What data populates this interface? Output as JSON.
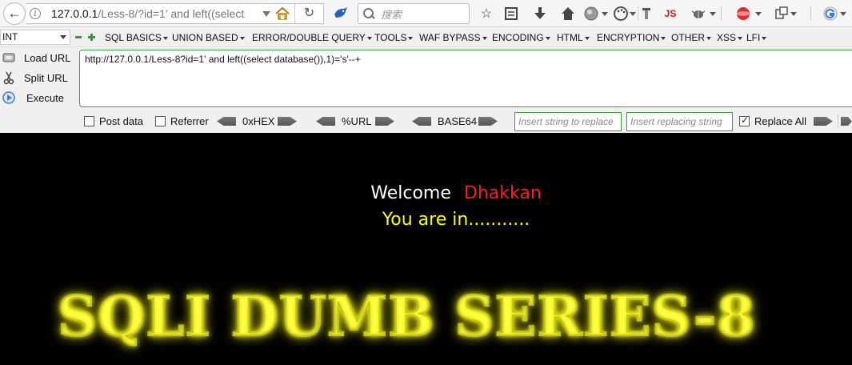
{
  "navbar": {
    "url_host": "127.0.0.1",
    "url_path": "/Less-8/?id=1' and left((select",
    "search_placeholder": "搜索",
    "js_label": "JS"
  },
  "hackbar": {
    "encoding_select": "INT",
    "menu": [
      "SQL BASICS",
      "UNION BASED",
      "ERROR/DOUBLE QUERY",
      "TOOLS",
      "WAF BYPASS",
      "ENCODING",
      "HTML",
      "ENCRYPTION",
      "OTHER",
      "XSS",
      "LFI"
    ],
    "load_url": "Load URL",
    "split_url": "Split URL",
    "execute": "Execute",
    "url_value": "http://127.0.0.1/Less-8?id=1' and left((select database()),1)='s'--+",
    "post_data": "Post data",
    "referrer": "Referrer",
    "hex": "0xHEX",
    "urlenc": "%URL",
    "base64": "BASE64",
    "replace_placeholder": "Insert string to replace",
    "replacing_placeholder": "Insert replacing string",
    "replace_all": "Replace All",
    "replace_all_checked": true
  },
  "page": {
    "welcome": "Welcome",
    "name": "Dhakkan",
    "status": "You are in...........",
    "banner": "SQLI DUMB SERIES-8"
  },
  "colors": {
    "page_bg": "#000000",
    "name": "#ff1a1a",
    "status": "#ffff00",
    "hackbar_accent": "#3aa13a"
  }
}
